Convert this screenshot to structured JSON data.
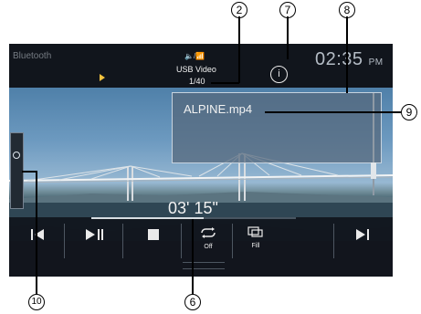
{
  "header": {
    "source_left": "Bluetooth",
    "status_icons": "🔈/📶",
    "source_name": "USB Video",
    "track_index": "1/40",
    "clock": "02:35",
    "clock_suffix": "PM"
  },
  "info_panel": {
    "file_name": "ALPINE.mp4"
  },
  "player": {
    "elapsed": "03' 15\"",
    "controls": [
      {
        "name": "previous-button",
        "label": ""
      },
      {
        "name": "play-pause-button",
        "label": ""
      },
      {
        "name": "stop-button",
        "label": ""
      },
      {
        "name": "repeat-button",
        "label": "Off"
      },
      {
        "name": "fill-button",
        "label": "Fill"
      },
      {
        "name": "next-button",
        "label": ""
      }
    ],
    "progress": 0.55
  },
  "callouts": [
    {
      "id": "2"
    },
    {
      "id": "7"
    },
    {
      "id": "8"
    },
    {
      "id": "9"
    },
    {
      "id": "10"
    },
    {
      "id": "6"
    }
  ],
  "colors": {
    "accent": "#f3c23e",
    "panel_border": "#c7d3de",
    "background": "#1b1f27"
  }
}
